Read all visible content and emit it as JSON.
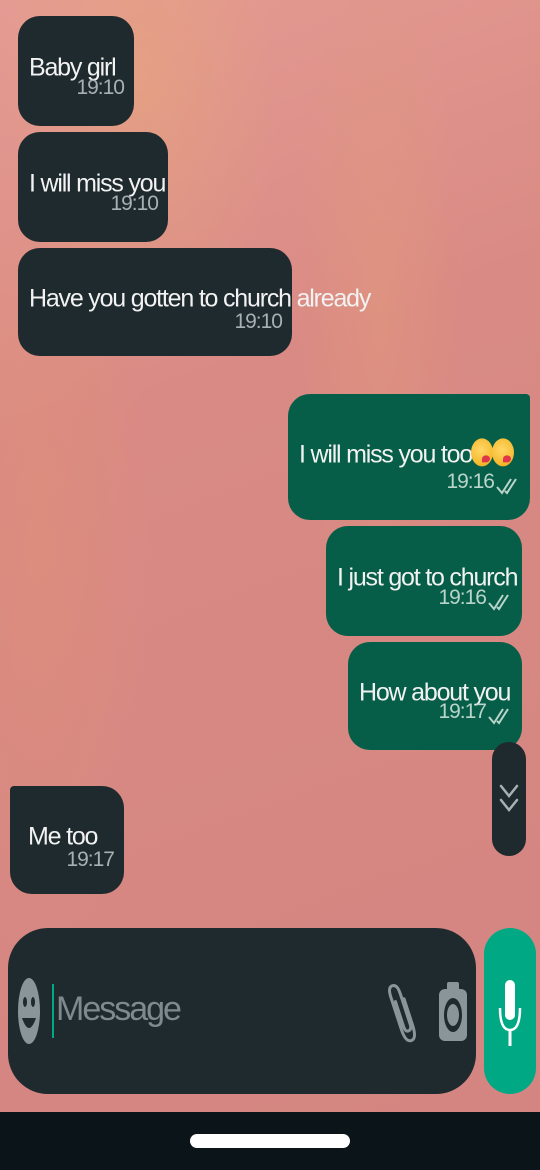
{
  "chat": {
    "messages": [
      {
        "direction": "incoming",
        "text": "Baby girl",
        "time": "19:10"
      },
      {
        "direction": "incoming",
        "text": "I will miss you",
        "time": "19:10"
      },
      {
        "direction": "incoming",
        "text": "Have you gotten to church already",
        "time": "19:10"
      },
      {
        "direction": "outgoing",
        "text": "I will miss you too",
        "emoji": "kissing-face-emoji x2",
        "time": "19:16",
        "status": "delivered-double-tick"
      },
      {
        "direction": "outgoing",
        "text": "I just got to church",
        "time": "19:16",
        "status": "delivered-double-tick"
      },
      {
        "direction": "outgoing",
        "text": "How about you",
        "time": "19:17",
        "status": "delivered-double-tick"
      },
      {
        "direction": "incoming",
        "text": "Me too",
        "time": "19:17"
      }
    ],
    "scroll_button_icon": "double-chevron-down-icon"
  },
  "composer": {
    "placeholder": "Message",
    "value": "",
    "emoji_icon": "emoji-face-icon",
    "attach_icon": "paperclip-icon",
    "camera_icon": "camera-icon",
    "mic_icon": "microphone-icon"
  },
  "colors": {
    "incoming_bubble": "#1f2a2e",
    "outgoing_bubble": "#075e48",
    "accent": "#00a884",
    "wallpaper": "#d98f88"
  }
}
